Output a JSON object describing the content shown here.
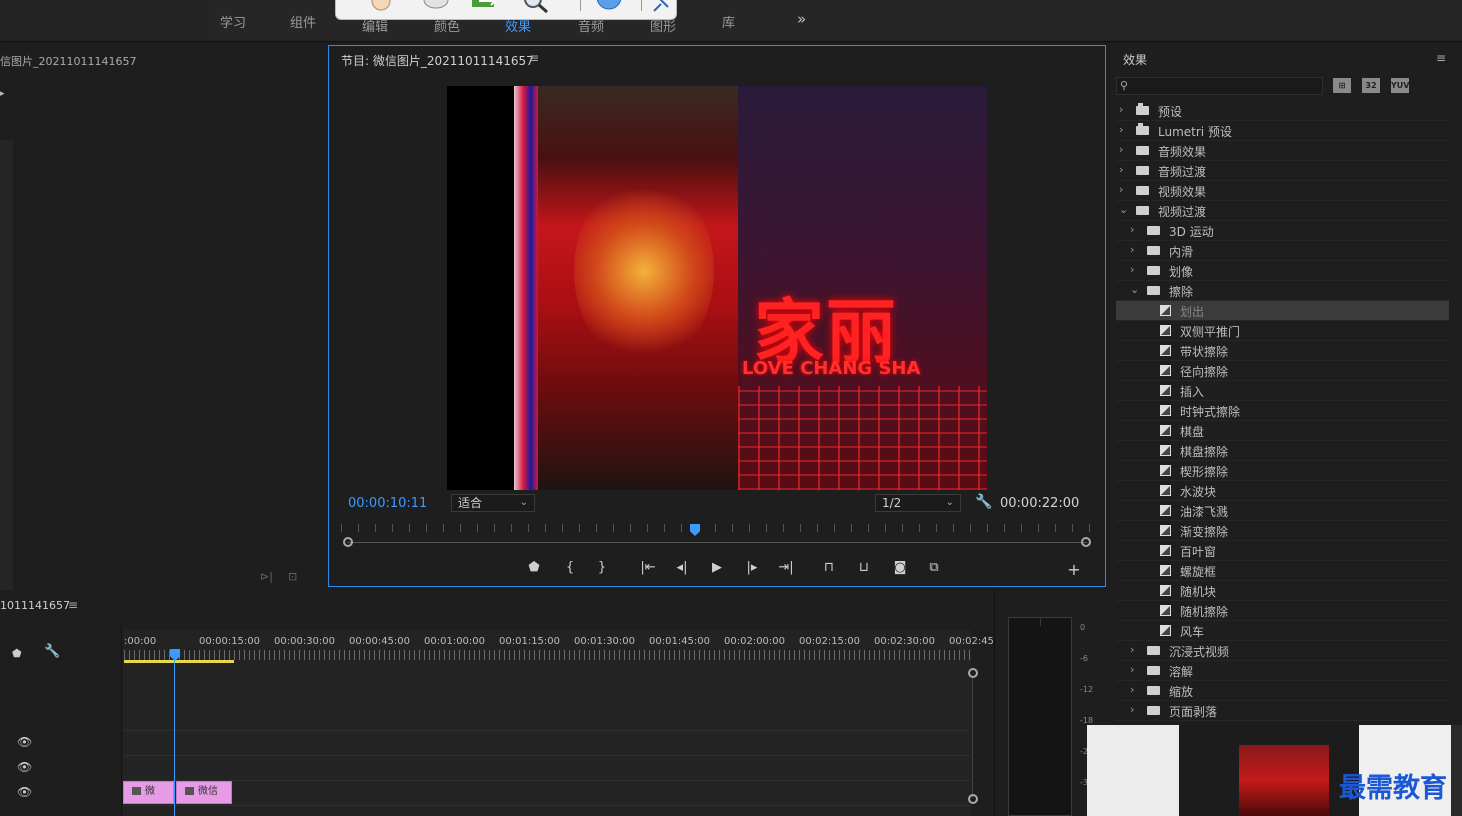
{
  "workspace": {
    "tabs": [
      "学习",
      "组件",
      "编辑",
      "颜色",
      "效果",
      "音频",
      "图形",
      "库"
    ],
    "more": "»"
  },
  "source_panel": {
    "title": "信图片_20211011141657"
  },
  "program": {
    "title": "节目: 微信图片_20211011141657",
    "menu": "≡",
    "current_timecode": "00:00:10:11",
    "fit_label": "适合",
    "resolution": "1/2",
    "duration_timecode": "00:00:22:00",
    "video_sign_cn": "家丽",
    "video_sign_en": "LOVE CHANG SHA",
    "controls": [
      "marker",
      "mark-in",
      "mark-out",
      "go-to-in",
      "step-back",
      "play",
      "step-forward",
      "go-to-out",
      "lift",
      "extract",
      "export-frame",
      "comparison-view",
      "add"
    ]
  },
  "effects": {
    "title": "效果",
    "menu": "≡",
    "buttons": [
      "32",
      "32",
      "YUV"
    ],
    "tree": [
      {
        "level": 0,
        "type": "bin",
        "expanded": false,
        "label": "预设"
      },
      {
        "level": 0,
        "type": "bin",
        "expanded": false,
        "label": "Lumetri 预设"
      },
      {
        "level": 0,
        "type": "folder",
        "expanded": false,
        "label": "音频效果"
      },
      {
        "level": 0,
        "type": "folder",
        "expanded": false,
        "label": "音频过渡"
      },
      {
        "level": 0,
        "type": "folder",
        "expanded": false,
        "label": "视频效果"
      },
      {
        "level": 0,
        "type": "folder",
        "expanded": true,
        "label": "视频过渡"
      },
      {
        "level": 1,
        "type": "folder",
        "expanded": false,
        "label": "3D 运动"
      },
      {
        "level": 1,
        "type": "folder",
        "expanded": false,
        "label": "内滑"
      },
      {
        "level": 1,
        "type": "folder",
        "expanded": false,
        "label": "划像"
      },
      {
        "level": 1,
        "type": "folder",
        "expanded": true,
        "label": "擦除"
      },
      {
        "level": 2,
        "type": "effect",
        "selected": true,
        "label": "划出"
      },
      {
        "level": 2,
        "type": "effect",
        "label": "双侧平推门"
      },
      {
        "level": 2,
        "type": "effect",
        "label": "带状擦除"
      },
      {
        "level": 2,
        "type": "effect",
        "label": "径向擦除"
      },
      {
        "level": 2,
        "type": "effect",
        "label": "插入"
      },
      {
        "level": 2,
        "type": "effect",
        "label": "时钟式擦除"
      },
      {
        "level": 2,
        "type": "effect",
        "label": "棋盘"
      },
      {
        "level": 2,
        "type": "effect",
        "label": "棋盘擦除"
      },
      {
        "level": 2,
        "type": "effect",
        "label": "楔形擦除"
      },
      {
        "level": 2,
        "type": "effect",
        "label": "水波块"
      },
      {
        "level": 2,
        "type": "effect",
        "label": "油漆飞溅"
      },
      {
        "level": 2,
        "type": "effect",
        "label": "渐变擦除"
      },
      {
        "level": 2,
        "type": "effect",
        "label": "百叶窗"
      },
      {
        "level": 2,
        "type": "effect",
        "label": "螺旋框"
      },
      {
        "level": 2,
        "type": "effect",
        "label": "随机块"
      },
      {
        "level": 2,
        "type": "effect",
        "label": "随机擦除"
      },
      {
        "level": 2,
        "type": "effect",
        "label": "风车"
      },
      {
        "level": 1,
        "type": "folder",
        "expanded": false,
        "label": "沉浸式视频"
      },
      {
        "level": 1,
        "type": "folder",
        "expanded": false,
        "label": "溶解"
      },
      {
        "level": 1,
        "type": "folder",
        "expanded": false,
        "label": "缩放"
      },
      {
        "level": 1,
        "type": "folder",
        "expanded": false,
        "label": "页面剥落"
      }
    ]
  },
  "timeline": {
    "title": "1011141657",
    "menu": "≡",
    "ruler": [
      ":00:00",
      "00:00:15:00",
      "00:00:30:00",
      "00:00:45:00",
      "00:01:00:00",
      "00:01:15:00",
      "00:01:30:00",
      "00:01:45:00",
      "00:02:00:00",
      "00:02:15:00",
      "00:02:30:00",
      "00:02:45:"
    ],
    "clips": [
      {
        "label": "微"
      },
      {
        "label": "微信"
      }
    ]
  },
  "audio_meter": {
    "scale": [
      "0",
      "-6",
      "-12",
      "-18",
      "-2",
      "-3"
    ]
  },
  "watermark": "最需教育"
}
